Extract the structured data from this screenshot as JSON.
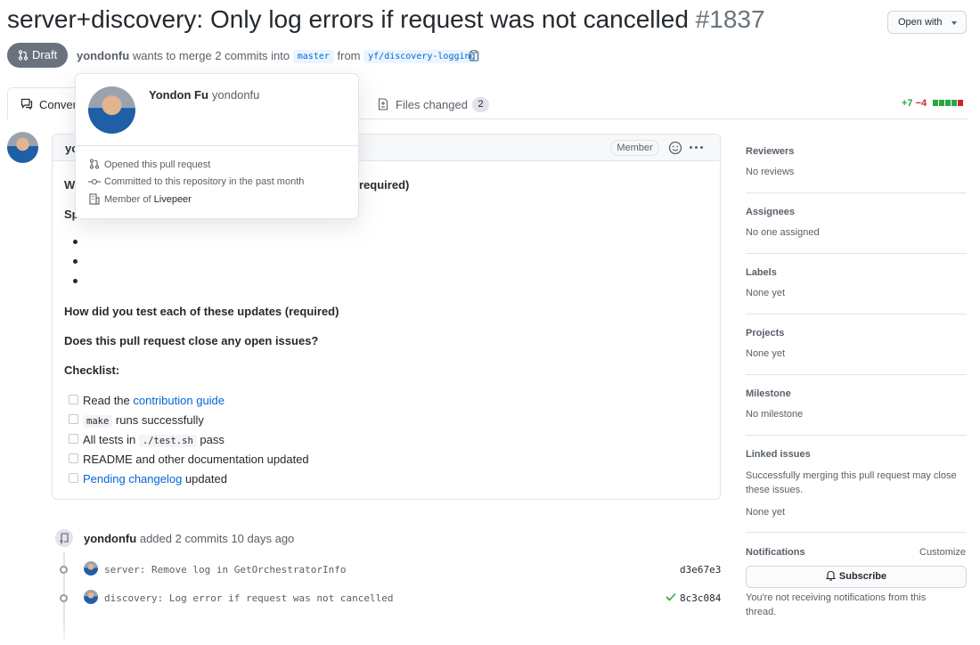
{
  "header": {
    "title": "server+discovery: Only log errors if request was not cancelled",
    "number": "#1837",
    "open_with": "Open with"
  },
  "status": {
    "state": "Draft",
    "author": "yondonfu",
    "merge_text": "wants to merge 2 commits into",
    "base_branch": "master",
    "from_text": "from",
    "head_branch": "yf/discovery-logging"
  },
  "tabs": {
    "conversation": "Conver",
    "files_changed": "Files changed",
    "files_count": "2"
  },
  "diffstat": {
    "additions": "+7",
    "deletions": "−4",
    "colors": [
      "#28a745",
      "#28a745",
      "#28a745",
      "#28a745",
      "#cb2431"
    ]
  },
  "comment": {
    "author": "yo",
    "badge": "Member",
    "heading1_tail": "required)",
    "heading2_head": "Sp",
    "bullets": [
      "",
      "",
      ""
    ],
    "q_test": "How did you test each of these updates (required)",
    "q_issues": "Does this pull request close any open issues?",
    "checklist_title": "Checklist:",
    "checklist": {
      "item1_pre": "Read the",
      "item1_link": "contribution guide",
      "item2_code": "make",
      "item2_post": "runs successfully",
      "item3_pre": "All tests in",
      "item3_code": "./test.sh",
      "item3_post": "pass",
      "item4": "README and other documentation updated",
      "item5_link": "Pending changelog",
      "item5_post": "updated"
    }
  },
  "hovercard": {
    "name": "Yondon Fu",
    "login": "yondonfu",
    "opened": "Opened this pull request",
    "committed": "Committed to this repository in the past month",
    "member_pre": "Member of",
    "org": "Livepeer"
  },
  "timeline": {
    "author": "yondonfu",
    "event": "added 2 commits 10 days ago",
    "commits": [
      {
        "message": "server: Remove log in GetOrchestratorInfo",
        "sha": "d3e67e3"
      },
      {
        "message": "discovery: Log error if request was not cancelled",
        "sha": "8c3c084"
      }
    ]
  },
  "sidebar": {
    "reviewers_title": "Reviewers",
    "reviewers_value": "No reviews",
    "assignees_title": "Assignees",
    "assignees_value": "No one assigned",
    "labels_title": "Labels",
    "labels_value": "None yet",
    "projects_title": "Projects",
    "projects_value": "None yet",
    "milestone_title": "Milestone",
    "milestone_value": "No milestone",
    "linked_title": "Linked issues",
    "linked_desc_1": "Successfully merging this pull request may close",
    "linked_desc_2": "these issues.",
    "linked_value": "None yet",
    "notifications_title": "Notifications",
    "customize": "Customize",
    "subscribe": "Subscribe",
    "notif_desc_1": "You're not receiving notifications from this",
    "notif_desc_2": "thread."
  }
}
